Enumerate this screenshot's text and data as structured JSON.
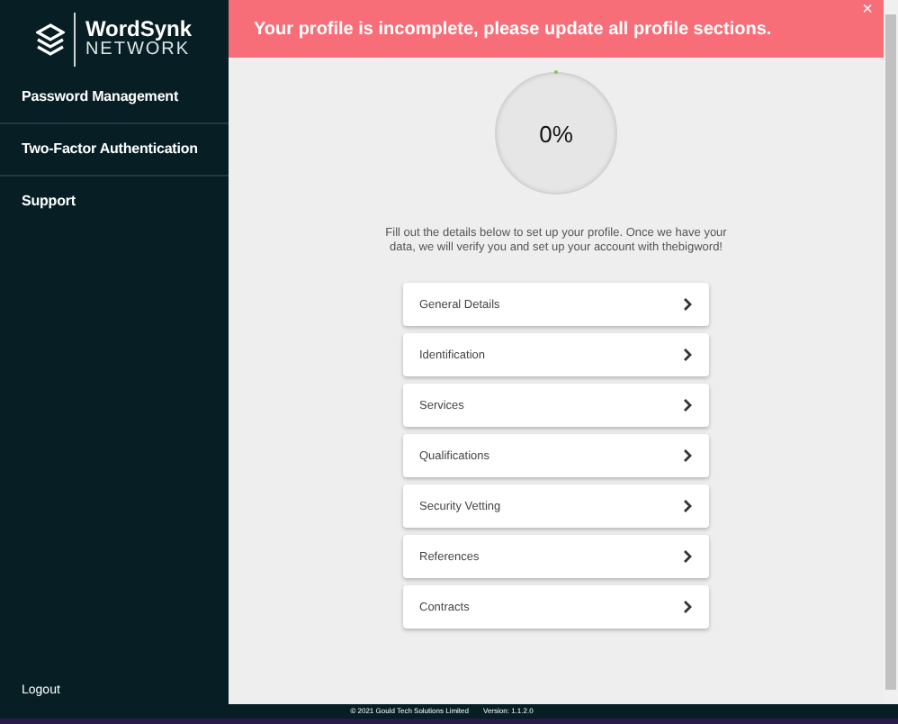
{
  "logo": {
    "name": "WordSynk",
    "subtitle": "NETWORK"
  },
  "sidebar": {
    "items": [
      {
        "label": "Password Management"
      },
      {
        "label": "Two-Factor Authentication"
      },
      {
        "label": "Support"
      }
    ],
    "logout": "Logout"
  },
  "alert": {
    "message": "Your profile is incomplete, please update all profile sections.",
    "close": "×"
  },
  "progress": {
    "reading": "0%"
  },
  "intro": "Fill out the details below to set up your profile. Once we have your data, we will verify you and set up your account with thebigword!",
  "sections": [
    {
      "label": "General Details"
    },
    {
      "label": "Identification"
    },
    {
      "label": "Services"
    },
    {
      "label": "Qualifications"
    },
    {
      "label": "Security Vetting"
    },
    {
      "label": "References"
    },
    {
      "label": "Contracts"
    }
  ],
  "footer": {
    "copyright": "© 2021 Gould Tech Solutions Limited",
    "version": "Version: 1.1.2.0"
  }
}
